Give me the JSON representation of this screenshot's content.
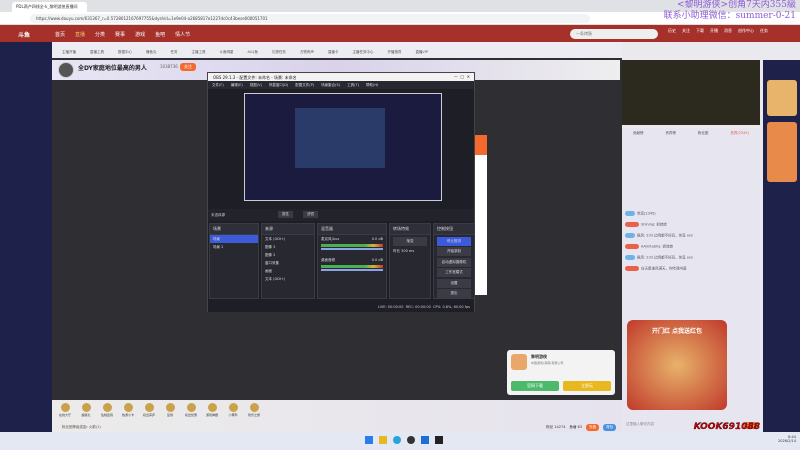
{
  "browser": {
    "tab_title": "PDL两卢四线全-k_黎明游侠直播间",
    "url": "https://www.douyu.com/631367_r=0.5728012167697755&dyshid=1e9e04-a2685817e1227dc0c43bese000051701"
  },
  "header": {
    "logo": "斗鱼",
    "nav": [
      "首页",
      "直播",
      "分类",
      "赛事",
      "游戏",
      "鱼吧",
      "情人节"
    ],
    "search_placeholder": "一条烤肠",
    "icons": [
      "历史",
      "关注",
      "下载",
      "开播",
      "消息",
      "创作中心",
      "任务"
    ]
  },
  "subnav": [
    "主播开播",
    "直播工具",
    "数据中心",
    "赚鱼丸",
    "任务",
    "主播工具",
    "斗鱼明星",
    "AI斗鱼",
    "礼物任务",
    "万物有声",
    "直播卡",
    "主播任务中心",
    "开播指导",
    "直播VIP",
    "开黑令",
    "礼物任务",
    "星光任务",
    "鱼丸商城",
    "会员"
  ],
  "streamer": {
    "title": "全DY家庭地位最高的男人",
    "room_id": "1038736",
    "follow": "关注"
  },
  "obs": {
    "title": "OBS 29.1.3 - 配置文件: 未命名 - 场景: 未命名",
    "menu": [
      "文件(F)",
      "编辑(E)",
      "视图(V)",
      "停靠窗口(D)",
      "配置文件(P)",
      "场景集合(S)",
      "工具(T)",
      "帮助(H)"
    ],
    "no_source": "未选择源",
    "properties": "属性",
    "filters": "滤镜",
    "scenes_title": "场景",
    "scenes": [
      "场景",
      "场景 2"
    ],
    "sources_title": "来源",
    "sources": [
      "文本 (GDI+)",
      "图像 3",
      "图像 2",
      "窗口采集",
      "画面",
      "文本 (GDI+)"
    ],
    "mixer_title": "混音器",
    "mixer": [
      {
        "name": "麦克风/Aux",
        "db": "0.0 dB"
      },
      {
        "name": "桌面音频",
        "db": "0.0 dB"
      }
    ],
    "transition_title": "转场特效",
    "transition": "渐变",
    "duration_label": "时长",
    "duration": "300 ms",
    "controls_title": "控制按钮",
    "controls": [
      "停止推流",
      "开始录制",
      "启动虚拟摄像机",
      "工作室模式",
      "设置",
      "退出"
    ],
    "status": {
      "live": "LIVE: 00:00:00",
      "rec": "REC: 00:00:00",
      "cpu": "CPU: 0.8%, 60.00 fps"
    }
  },
  "chat": {
    "tabs": [
      "贡献榜",
      "贵宾榜",
      "粉丝团",
      "贵宾(2345)"
    ],
    "lines": [
      "贵宾(2345)",
      "Shining: 抓娃娃",
      "稳风: 233 边境都不好玩，你真 xxx",
      "AAmitabha: 抓娃娃",
      "稳风: 233 边境都不好玩，你真 xxx",
      "白天是谁风满天，你吃我内幕"
    ],
    "input_placeholder": "这里输入聊天内容",
    "send": "发送",
    "promo": "开门红 点我送红包"
  },
  "game_card": {
    "name": "黎明游侠",
    "company": "中国游戏(海南)有限公司",
    "btn1": "官网下载",
    "btn2": "立即玩"
  },
  "gifts": [
    "在线大厅",
    "超级礼",
    "仙桃签到",
    "热游小卡",
    "初出茅庐",
    "签到",
    "初出优惠",
    "游戏神器",
    "小黄鸭",
    "欢乐之旅"
  ],
  "gift_footer": {
    "notice": "粉丝团等级奖励: 火箭(1)",
    "fans": "粉丝 14274",
    "level": "鱼塘 63",
    "btn1": "充值",
    "btn2": "背包"
  },
  "watermark": [
    "<黎明游侠>创角7天内355級",
    "联系小助理微信：summer-0-21"
  ],
  "overlay_id": "KOOK691088",
  "taskbar": {
    "time": "8:44",
    "date": "2026/2/14"
  }
}
